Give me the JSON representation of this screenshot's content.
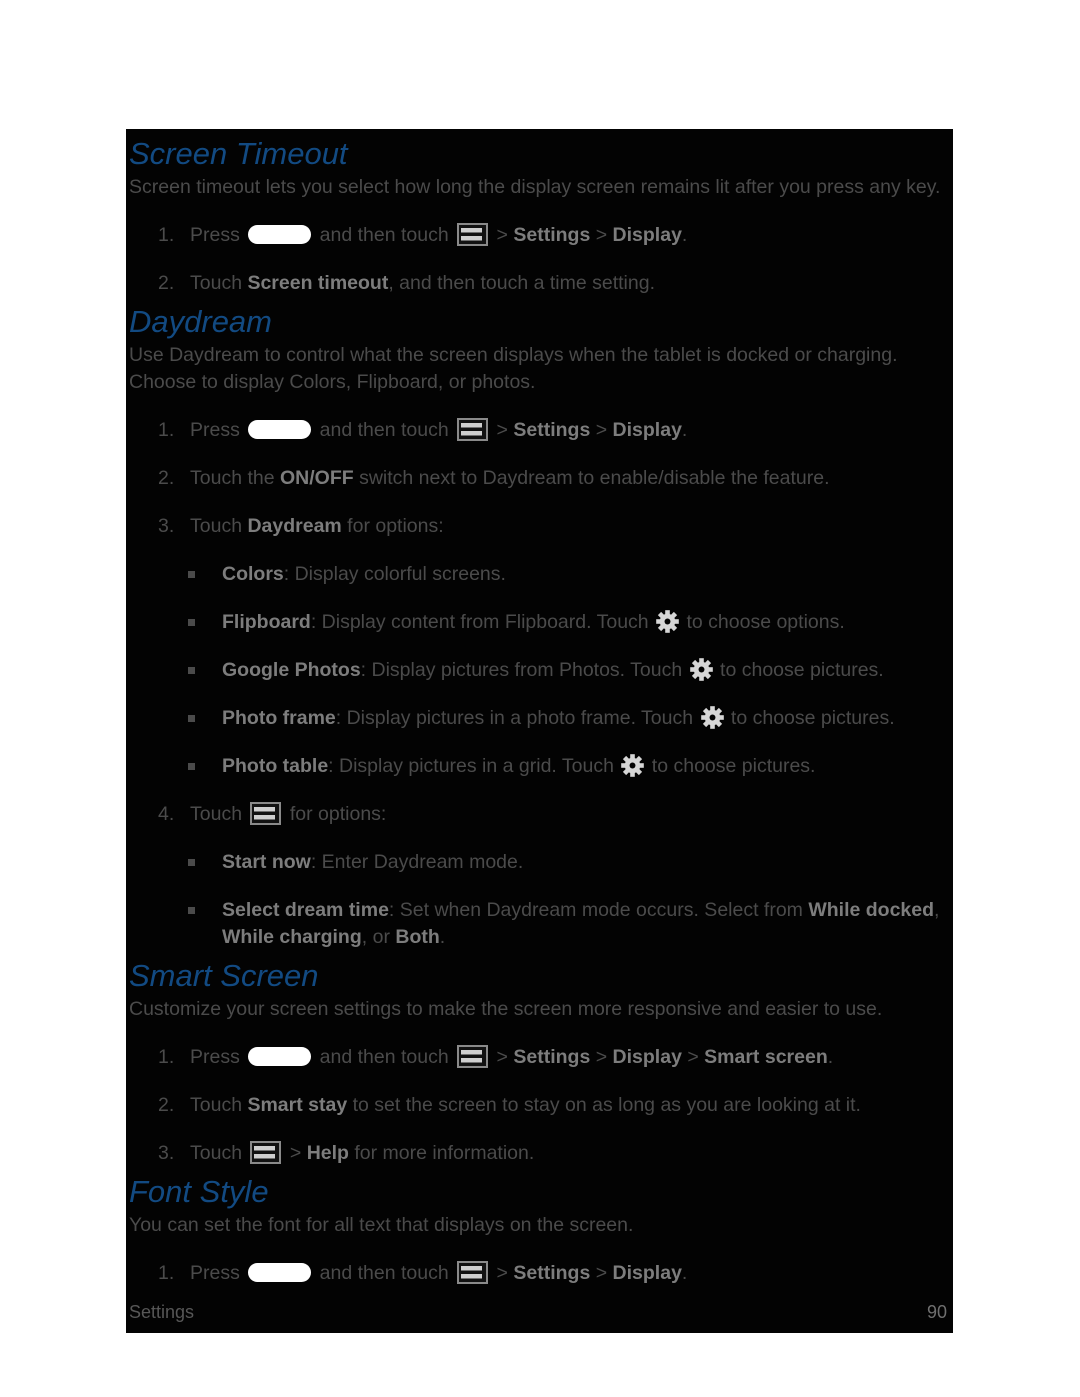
{
  "page": {
    "background_color": "#ffffff",
    "content_background_color": "#030303",
    "heading_color": "#124a82",
    "body_text_color": "#4b4b4b",
    "bold_text_color": "#7d7d7d"
  },
  "footer": {
    "left_label": "Settings",
    "page_number": "90"
  },
  "icons": {
    "home_key": "home-key-pill-icon",
    "menu": "menu-icon",
    "gear": "gear-icon"
  },
  "sections": [
    {
      "id": "screen-timeout",
      "heading": "Screen Timeout",
      "intro": "Screen timeout lets you select how long the display screen remains lit after you press any key.",
      "steps": [
        {
          "num": "1.",
          "parts": [
            {
              "t": "text",
              "v": "Press "
            },
            {
              "t": "icon",
              "v": "home-key"
            },
            {
              "t": "text",
              "v": " and then touch "
            },
            {
              "t": "icon",
              "v": "menu"
            },
            {
              "t": "text",
              "v": " > "
            },
            {
              "t": "bold",
              "v": "Settings"
            },
            {
              "t": "text",
              "v": " > "
            },
            {
              "t": "bold",
              "v": "Display"
            },
            {
              "t": "text",
              "v": "."
            }
          ]
        },
        {
          "num": "2.",
          "parts": [
            {
              "t": "text",
              "v": "Touch "
            },
            {
              "t": "bold",
              "v": "Screen timeout"
            },
            {
              "t": "text",
              "v": ", and then touch a time setting."
            }
          ]
        }
      ]
    },
    {
      "id": "daydream",
      "heading": "Daydream",
      "intro": "Use Daydream to control what the screen displays when the tablet is docked or charging. Choose to display Colors, Flipboard, or photos.",
      "steps": [
        {
          "num": "1.",
          "parts": [
            {
              "t": "text",
              "v": "Press "
            },
            {
              "t": "icon",
              "v": "home-key"
            },
            {
              "t": "text",
              "v": " and then touch "
            },
            {
              "t": "icon",
              "v": "menu"
            },
            {
              "t": "text",
              "v": " > "
            },
            {
              "t": "bold",
              "v": "Settings"
            },
            {
              "t": "text",
              "v": " > "
            },
            {
              "t": "bold",
              "v": "Display"
            },
            {
              "t": "text",
              "v": "."
            }
          ]
        },
        {
          "num": "2.",
          "parts": [
            {
              "t": "text",
              "v": "Touch the "
            },
            {
              "t": "bold",
              "v": "ON/OFF"
            },
            {
              "t": "text",
              "v": " switch next to Daydream to enable/disable the feature."
            }
          ]
        },
        {
          "num": "3.",
          "parts": [
            {
              "t": "text",
              "v": "Touch "
            },
            {
              "t": "bold",
              "v": "Daydream"
            },
            {
              "t": "text",
              "v": " for options:"
            }
          ],
          "bullets": [
            [
              {
                "t": "bold",
                "v": "Colors"
              },
              {
                "t": "text",
                "v": ": Display colorful screens."
              }
            ],
            [
              {
                "t": "bold",
                "v": "Flipboard"
              },
              {
                "t": "text",
                "v": ": Display content from Flipboard. Touch "
              },
              {
                "t": "icon",
                "v": "gear"
              },
              {
                "t": "text",
                "v": " to choose options."
              }
            ],
            [
              {
                "t": "bold",
                "v": "Google Photos"
              },
              {
                "t": "text",
                "v": ": Display pictures from Photos. Touch "
              },
              {
                "t": "icon",
                "v": "gear"
              },
              {
                "t": "text",
                "v": " to choose pictures."
              }
            ],
            [
              {
                "t": "bold",
                "v": "Photo frame"
              },
              {
                "t": "text",
                "v": ": Display pictures in a photo frame. Touch "
              },
              {
                "t": "icon",
                "v": "gear"
              },
              {
                "t": "text",
                "v": " to choose pictures."
              }
            ],
            [
              {
                "t": "bold",
                "v": "Photo table"
              },
              {
                "t": "text",
                "v": ": Display pictures in a grid. Touch "
              },
              {
                "t": "icon",
                "v": "gear"
              },
              {
                "t": "text",
                "v": " to choose pictures."
              }
            ]
          ]
        },
        {
          "num": "4.",
          "parts": [
            {
              "t": "text",
              "v": "Touch "
            },
            {
              "t": "icon",
              "v": "menu"
            },
            {
              "t": "text",
              "v": " for options:"
            }
          ],
          "bullets": [
            [
              {
                "t": "bold",
                "v": "Start now"
              },
              {
                "t": "text",
                "v": ": Enter Daydream mode."
              }
            ],
            [
              {
                "t": "bold",
                "v": "Select dream time"
              },
              {
                "t": "text",
                "v": ": Set when Daydream mode occurs. Select from "
              },
              {
                "t": "bold",
                "v": "While docked"
              },
              {
                "t": "text",
                "v": ", "
              },
              {
                "t": "bold",
                "v": "While charging"
              },
              {
                "t": "text",
                "v": ", or "
              },
              {
                "t": "bold",
                "v": "Both"
              },
              {
                "t": "text",
                "v": "."
              }
            ]
          ]
        }
      ]
    },
    {
      "id": "smart-screen",
      "heading": "Smart Screen",
      "intro": "Customize your screen settings to make the screen more responsive and easier to use.",
      "steps": [
        {
          "num": "1.",
          "parts": [
            {
              "t": "text",
              "v": "Press "
            },
            {
              "t": "icon",
              "v": "home-key"
            },
            {
              "t": "text",
              "v": " and then touch "
            },
            {
              "t": "icon",
              "v": "menu"
            },
            {
              "t": "text",
              "v": " > "
            },
            {
              "t": "bold",
              "v": "Settings"
            },
            {
              "t": "text",
              "v": " > "
            },
            {
              "t": "bold",
              "v": "Display"
            },
            {
              "t": "text",
              "v": " > "
            },
            {
              "t": "bold",
              "v": "Smart screen"
            },
            {
              "t": "text",
              "v": "."
            }
          ]
        },
        {
          "num": "2.",
          "parts": [
            {
              "t": "text",
              "v": "Touch "
            },
            {
              "t": "bold",
              "v": "Smart stay"
            },
            {
              "t": "text",
              "v": " to set the screen to stay on as long as you are looking at it."
            }
          ]
        },
        {
          "num": "3.",
          "parts": [
            {
              "t": "text",
              "v": "Touch "
            },
            {
              "t": "icon",
              "v": "menu"
            },
            {
              "t": "text",
              "v": " > "
            },
            {
              "t": "bold",
              "v": "Help"
            },
            {
              "t": "text",
              "v": " for more information."
            }
          ]
        }
      ]
    },
    {
      "id": "font-style",
      "heading": "Font Style",
      "intro": "You can set the font for all text that displays on the screen.",
      "steps": [
        {
          "num": "1.",
          "parts": [
            {
              "t": "text",
              "v": "Press "
            },
            {
              "t": "icon",
              "v": "home-key"
            },
            {
              "t": "text",
              "v": " and then touch "
            },
            {
              "t": "icon",
              "v": "menu"
            },
            {
              "t": "text",
              "v": " > "
            },
            {
              "t": "bold",
              "v": "Settings"
            },
            {
              "t": "text",
              "v": " > "
            },
            {
              "t": "bold",
              "v": "Display"
            },
            {
              "t": "text",
              "v": "."
            }
          ]
        }
      ]
    }
  ]
}
